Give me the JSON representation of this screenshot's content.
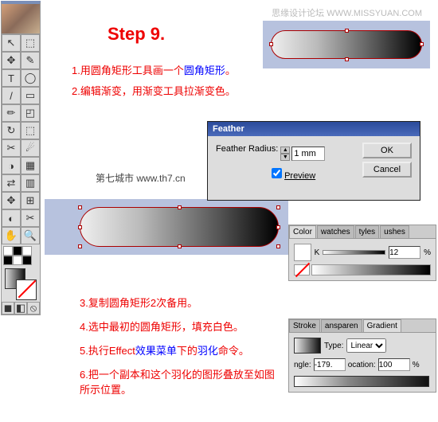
{
  "watermark": "思缘设计论坛  WWW.MISSYUAN.COM",
  "step_title": "Step 9.",
  "lines": {
    "l1a": "1.用圆角矩形工具画一个",
    "l1b": "圆角矩形",
    "l1c": "。",
    "l2": "2.编辑渐变，用渐变工具拉渐变色。",
    "l3": "3.复制圆角矩形2次备用。",
    "l4": "4.选中最初的圆角矩形，填充白色。",
    "l5a": "5.执行Effect",
    "l5b": "效果菜单",
    "l5c": "下的",
    "l5d": "羽化",
    "l5e": "命令。",
    "l6": "6.把一个副本和这个羽化的图形叠放至如图所示位置。"
  },
  "city": "第七城市  www.th7.cn",
  "dialog": {
    "title": "Feather",
    "radius_label": "Feather Radius:",
    "radius_value": "1 mm",
    "preview": "Preview",
    "ok": "OK",
    "cancel": "Cancel"
  },
  "color_panel": {
    "tabs": [
      "Color",
      "watches",
      "tyles",
      "ushes"
    ],
    "mode": "K",
    "value": "12",
    "pct": "%"
  },
  "stroke_panel": {
    "tabs": [
      "Stroke",
      "ansparen",
      "Gradient"
    ],
    "type_label": "Type:",
    "type_value": "Linear",
    "angle_label": "ngle:",
    "angle_value": "-179.",
    "loc_label": "ocation:",
    "loc_value": "100",
    "pct": "%"
  },
  "tool_icons": [
    "↖",
    "⬚",
    "✥",
    "✎",
    "T",
    "◯",
    "/",
    "▭",
    "✏",
    "◰",
    "↻",
    "⬚",
    "✂",
    "☄",
    "◑",
    "▦",
    "⇄",
    "▥",
    "✥",
    "⊞",
    "◐",
    "✂",
    "✋",
    "🔍"
  ]
}
